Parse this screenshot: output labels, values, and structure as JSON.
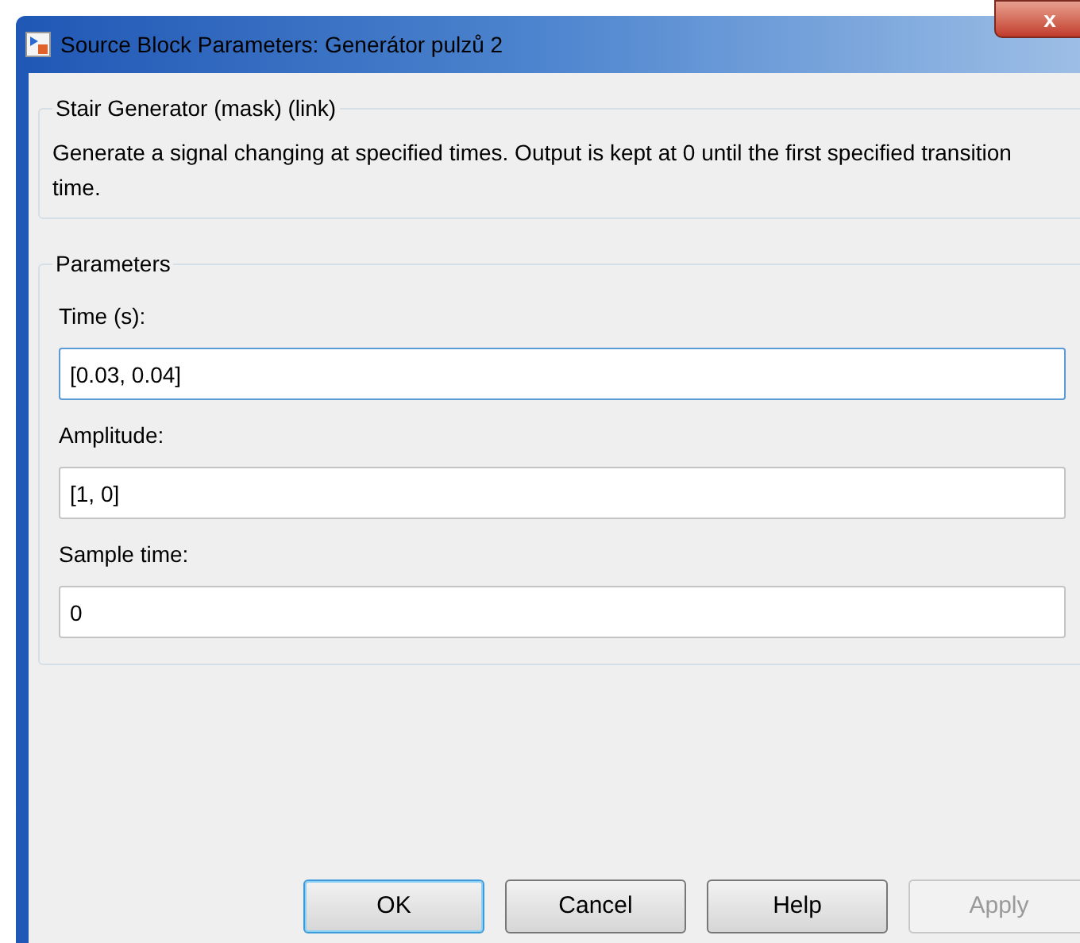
{
  "window": {
    "title": "Source Block Parameters: Generátor pulzů 2",
    "close": "x"
  },
  "description_group": {
    "title": "Stair Generator (mask) (link)",
    "text": "Generate a signal changing at specified times. Output is kept at 0 until the first specified transition time."
  },
  "parameters_group": {
    "title": "Parameters",
    "fields": [
      {
        "label": "Time (s):",
        "value": "[0.03, 0.04]",
        "focused": true
      },
      {
        "label": "Amplitude:",
        "value": "[1, 0]",
        "focused": false
      },
      {
        "label": "Sample time:",
        "value": "0",
        "focused": false
      }
    ]
  },
  "buttons": [
    {
      "label": "OK",
      "default": true,
      "disabled": false
    },
    {
      "label": "Cancel",
      "default": false,
      "disabled": false
    },
    {
      "label": "Help",
      "default": false,
      "disabled": false
    },
    {
      "label": "Apply",
      "default": false,
      "disabled": true
    }
  ]
}
